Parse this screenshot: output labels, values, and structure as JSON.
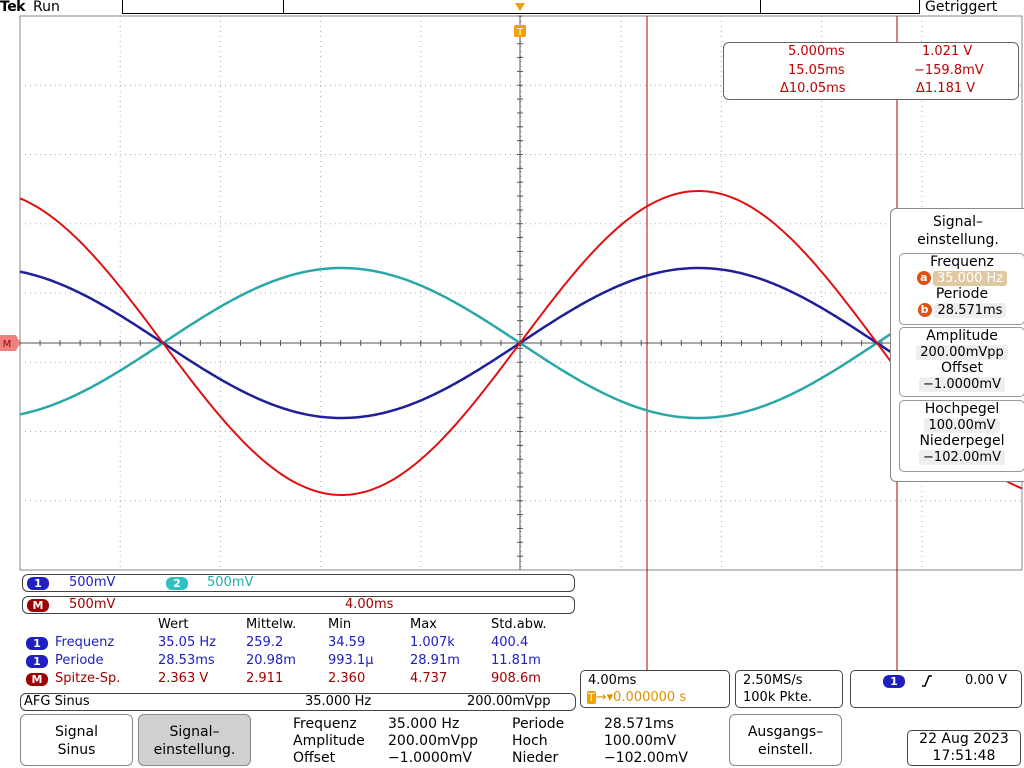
{
  "top": {
    "brand": "Tek",
    "run_state": "Run",
    "trigger_state": "Getriggert"
  },
  "cursor_readout": {
    "a_time": "5.000ms",
    "a_value": "1.021 V",
    "b_time": "15.05ms",
    "b_value": "−159.8mV",
    "delta_time": "Δ10.05ms",
    "delta_value": "Δ1.181 V"
  },
  "side_menu": {
    "title": "Signal–\neinstellung.",
    "freq_label": "Frequenz",
    "freq_value": "35.000 Hz",
    "freq_knob": "a",
    "period_label": "Periode",
    "period_value": "28.571ms",
    "period_knob": "b",
    "amp_label": "Amplitude",
    "amp_value": "200.00mVpp",
    "offset_label": "Offset",
    "offset_value": "−1.0000mV",
    "high_label": "Hochpegel",
    "high_value": "100.00mV",
    "low_label": "Niederpegel",
    "low_value": "−102.00mV"
  },
  "channels": {
    "ch1_badge": "1",
    "ch1_scale": "500mV",
    "ch2_badge": "2",
    "ch2_scale": "500mV",
    "math_badge": "M",
    "math_scale": "500mV",
    "math_time": "4.00ms"
  },
  "measurements": {
    "headers": [
      "Wert",
      "Mittelw.",
      "Min",
      "Max",
      "Std.abw."
    ],
    "rows": [
      {
        "badge": "1",
        "name": "Frequenz",
        "vals": [
          "35.05 Hz",
          "259.2",
          "34.59",
          "1.007k",
          "400.4"
        ],
        "color": "#2020c0"
      },
      {
        "badge": "1",
        "name": "Periode",
        "vals": [
          "28.53ms",
          "20.98m",
          "993.1µ",
          "28.91m",
          "11.81m"
        ],
        "color": "#2020c0"
      },
      {
        "badge": "M",
        "name": "Spitze-Sp.",
        "vals": [
          "2.363 V",
          "2.911",
          "2.360",
          "4.737",
          "908.6m"
        ],
        "color": "#a00000"
      }
    ]
  },
  "afg": {
    "label": "AFG Sinus",
    "freq": "35.000 Hz",
    "ampl": "200.00mVpp"
  },
  "timebase": {
    "scale": "4.00ms",
    "trig_pos": "0.000000 s",
    "trig_marker": "T"
  },
  "acquisition": {
    "rate": "2.50MS/s",
    "points": "100k Pkte."
  },
  "trigger": {
    "channel": "1",
    "slope_icon": "rising-edge",
    "level": "0.00 V"
  },
  "bottom_menu": {
    "btn1_line1": "Signal",
    "btn1_line2": "Sinus",
    "btn2_line1": "Signal–",
    "btn2_line2": "einstellung.",
    "freq_label": "Frequenz",
    "freq_value": "35.000 Hz",
    "amp_label": "Amplitude",
    "amp_value": "200.00mVpp",
    "offset_label": "Offset",
    "offset_value": "−1.0000mV",
    "period_label": "Periode",
    "period_value": "28.571ms",
    "high_label": "Hoch",
    "high_value": "100.00mV",
    "low_label": "Nieder",
    "low_value": "−102.00mV",
    "btn3_line1": "Ausgangs–",
    "btn3_line2": "einstell."
  },
  "datetime": {
    "date": "22 Aug 2023",
    "time": "17:51:48"
  },
  "colors": {
    "ch1": "#1f1f9a",
    "ch2": "#2aa8a8",
    "math": "#e01010",
    "cursor": "#b00000",
    "grid": "#999999"
  }
}
